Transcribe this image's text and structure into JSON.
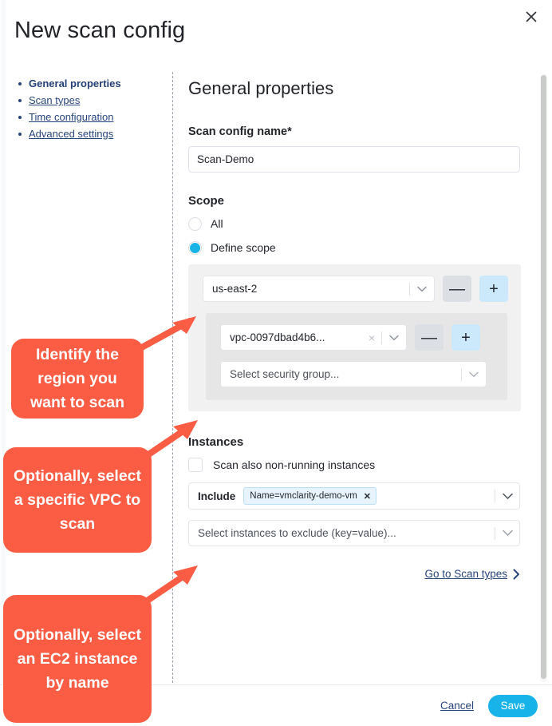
{
  "window": {
    "title": "New scan config",
    "close_icon": "close-icon"
  },
  "sidebar": {
    "items": [
      {
        "label": "General properties",
        "active": true
      },
      {
        "label": "Scan types",
        "active": false
      },
      {
        "label": "Time configuration",
        "active": false
      },
      {
        "label": "Advanced settings",
        "active": false
      }
    ]
  },
  "main": {
    "section_title": "General properties",
    "scan_config_name": {
      "label": "Scan config name*",
      "value": "Scan-Demo"
    },
    "scope": {
      "title": "Scope",
      "options": [
        {
          "label": "All",
          "selected": false
        },
        {
          "label": "Define scope",
          "selected": true
        }
      ],
      "region": {
        "value": "us-east-2",
        "remove_label": "—",
        "add_label": "+"
      },
      "vpc": {
        "value": "vpc-0097dbad4b6...",
        "clear_label": "×",
        "remove_label": "—",
        "add_label": "+"
      },
      "security_group": {
        "placeholder": "Select security group..."
      }
    },
    "instances": {
      "title": "Instances",
      "non_running_checkbox": {
        "label": "Scan also non-running instances",
        "checked": false
      },
      "include": {
        "label": "Include",
        "tag": "Name=vmclarity-demo-vm",
        "tag_remove": "✕"
      },
      "exclude": {
        "placeholder": "Select instances to exclude (key=value)..."
      }
    },
    "goto_link": "Go to Scan types"
  },
  "footer": {
    "cancel_label": "Cancel",
    "save_label": "Save"
  },
  "annotations": [
    {
      "text": "Identify the region you want to scan"
    },
    {
      "text": "Optionally, select a specific VPC to scan"
    },
    {
      "text": "Optionally, select an EC2 instance by name"
    }
  ],
  "colors": {
    "accent_blue": "#18b4e9",
    "link_navy": "#27457c",
    "annotation_red": "#fa5c44",
    "plus_button_bg": "#cce8fb",
    "minus_button_bg": "#dcdfe3"
  }
}
